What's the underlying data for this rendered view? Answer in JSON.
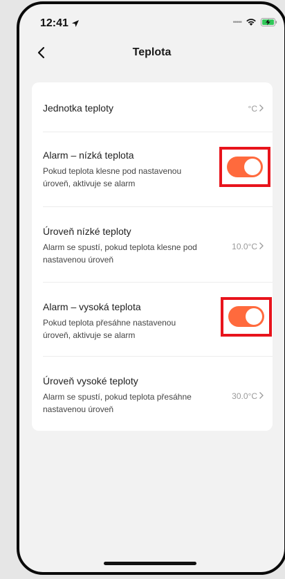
{
  "status_bar": {
    "time": "12:41"
  },
  "nav": {
    "title": "Teplota"
  },
  "settings": {
    "unit": {
      "label": "Jednotka teploty",
      "value": "°C"
    },
    "low_alarm": {
      "label": "Alarm – nízká teplota",
      "description": "Pokud teplota klesne pod nastavenou úroveň, aktivuje se alarm",
      "enabled": true
    },
    "low_level": {
      "label": "Úroveň nízké teploty",
      "description": "Alarm se spustí, pokud teplota klesne pod nastavenou úroveň",
      "value": "10.0°C"
    },
    "high_alarm": {
      "label": "Alarm – vysoká teplota",
      "description": "Pokud teplota přesáhne nastavenou úroveň, aktivuje se alarm",
      "enabled": true
    },
    "high_level": {
      "label": "Úroveň vysoké teploty",
      "description": "Alarm se spustí, pokud teplota přesáhne nastavenou úroveň",
      "value": "30.0°C"
    }
  },
  "colors": {
    "toggle_on": "#ff6a3d",
    "highlight": "#e8141c"
  }
}
